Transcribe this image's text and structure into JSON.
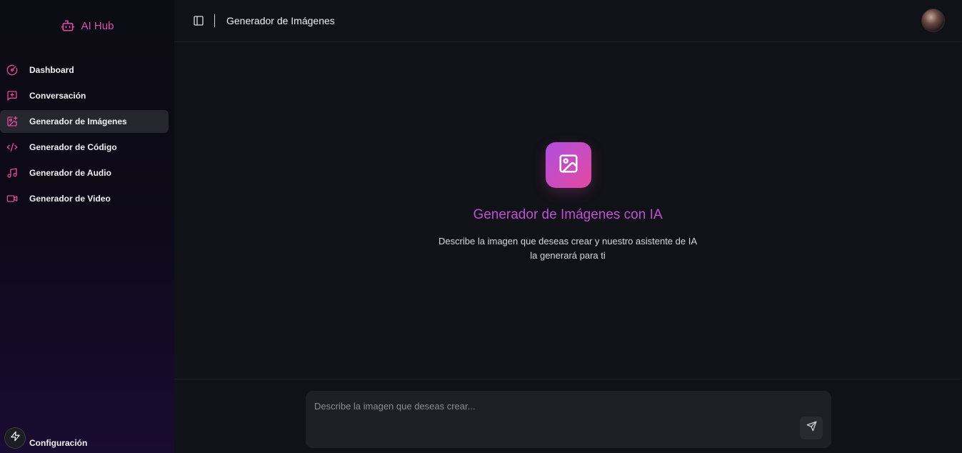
{
  "app": {
    "brand_name": "AI Hub",
    "brand_icon": "bot-icon",
    "accent_color": "#d94fb8"
  },
  "sidebar": {
    "items": [
      {
        "label": "Dashboard",
        "icon": "gauge-icon",
        "active": false
      },
      {
        "label": "Conversación",
        "icon": "message-plus-icon",
        "active": false
      },
      {
        "label": "Generador de Imágenes",
        "icon": "image-plus-icon",
        "active": true
      },
      {
        "label": "Generador de Código",
        "icon": "code-icon",
        "active": false
      },
      {
        "label": "Generador de Audio",
        "icon": "music-icon",
        "active": false
      },
      {
        "label": "Generador de Video",
        "icon": "video-icon",
        "active": false
      }
    ],
    "settings_label": "Configuración",
    "settings_icon": "zap-icon"
  },
  "topbar": {
    "title": "Generador de Imágenes",
    "toggle_icon": "panel-left-icon",
    "avatar": "user-avatar"
  },
  "hero": {
    "icon": "image-icon",
    "title": "Generador de Imágenes con IA",
    "description_line1": "Describe la imagen que deseas crear y nuestro asistente de IA",
    "description_line2": "la generará para ti"
  },
  "composer": {
    "placeholder": "Describe la imagen que deseas crear...",
    "value": "",
    "send_icon": "send-icon"
  }
}
